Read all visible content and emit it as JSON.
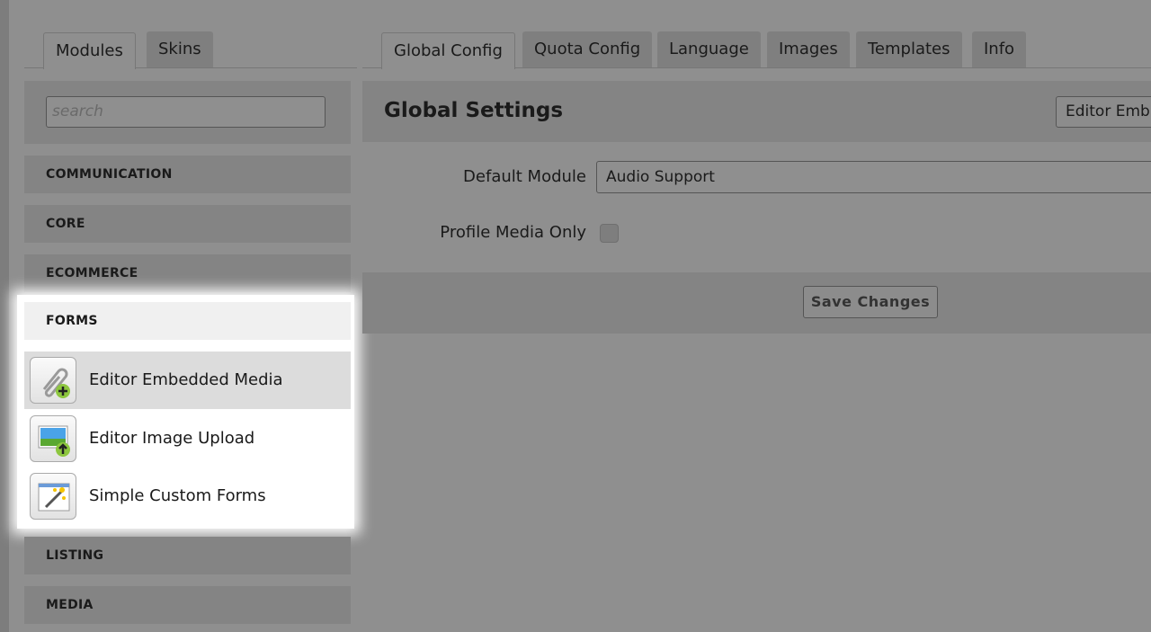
{
  "left_tabs": [
    {
      "label": "Modules",
      "active": true
    },
    {
      "label": "Skins",
      "active": false
    }
  ],
  "right_tabs": [
    {
      "label": "Global Config",
      "active": true
    },
    {
      "label": "Quota Config"
    },
    {
      "label": "Language"
    },
    {
      "label": "Images"
    },
    {
      "label": "Templates"
    },
    {
      "label": "Info"
    }
  ],
  "search": {
    "placeholder": "search"
  },
  "categories": [
    "COMMUNICATION",
    "CORE",
    "ECOMMERCE",
    "FORMS",
    "LISTING",
    "MEDIA"
  ],
  "forms_items": [
    {
      "label": "Editor Embedded Media",
      "icon": "paperclip-add-icon",
      "selected": true
    },
    {
      "label": "Editor Image Upload",
      "icon": "image-upload-icon"
    },
    {
      "label": "Simple Custom Forms",
      "icon": "magic-wand-form-icon"
    }
  ],
  "settings": {
    "title": "Global Settings",
    "module_select": "Editor Emb",
    "default_module_label": "Default Module",
    "default_module_value": "Audio Support",
    "profile_media_label": "Profile Media Only",
    "profile_media_checked": false,
    "save_label": "Save Changes"
  }
}
